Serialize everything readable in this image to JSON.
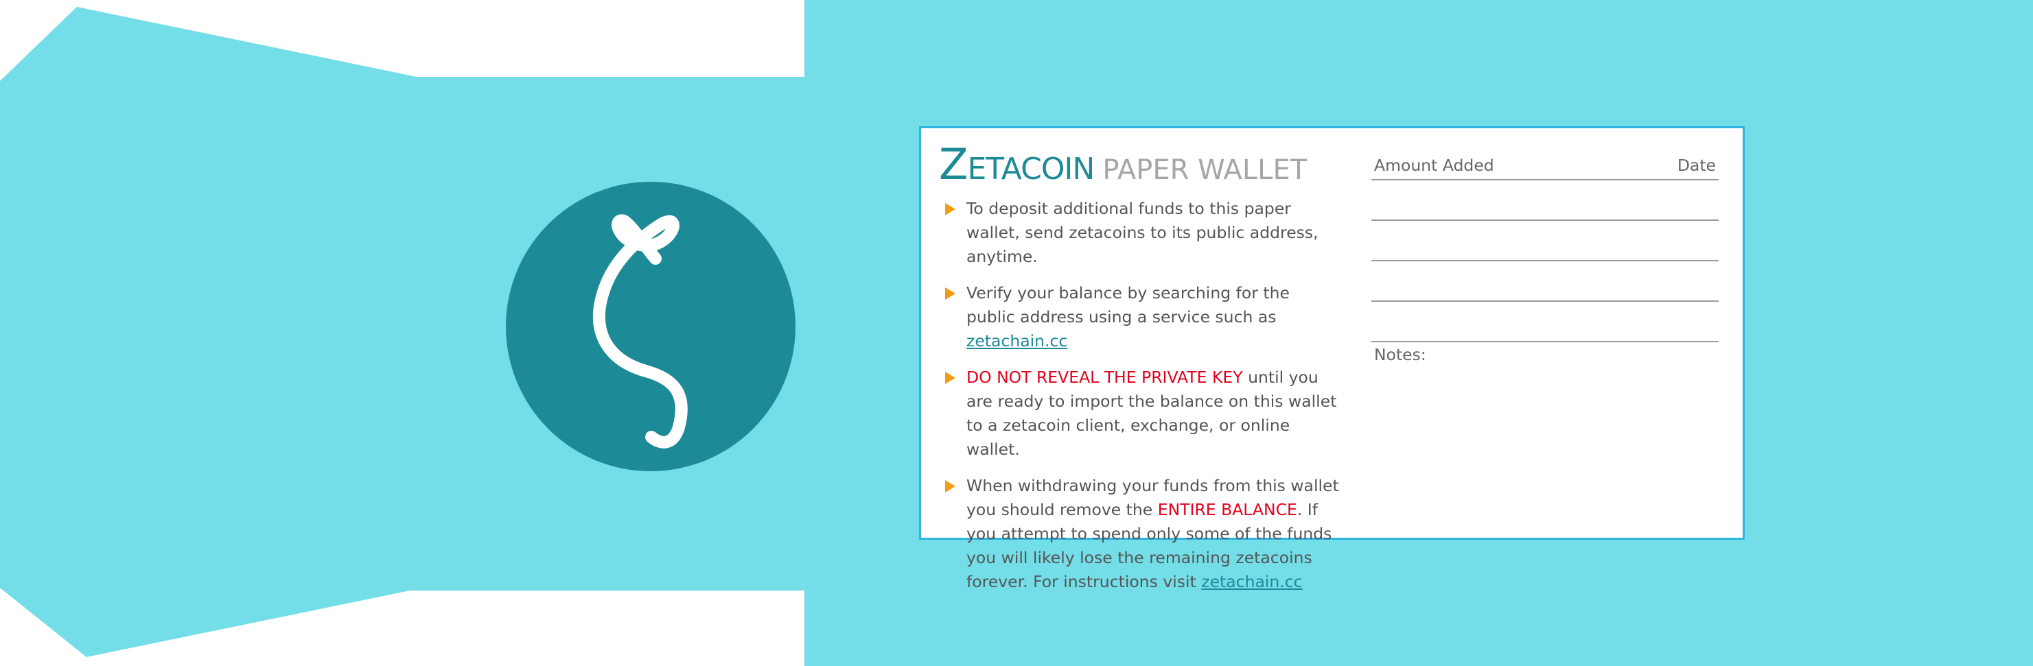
{
  "colors": {
    "background_teal": "#73dee8",
    "logo_circle": "#1d8a98",
    "brand_teal": "#1d8a98",
    "card_border": "#2fb4e0",
    "bullet_arrow": "#f39c12",
    "warning_red": "#e3001b"
  },
  "logo": {
    "symbol": "ζ",
    "icon": "zeta-symbol-icon"
  },
  "card": {
    "title_initial": "Z",
    "title_rest": "ETACOIN",
    "title_sub": "PAPER WALLET",
    "bullets": [
      {
        "text": "To deposit additional funds to this paper wallet, send zetacoins to its public address, anytime."
      },
      {
        "text": "Verify your balance by searching for the public address using a service such as",
        "link": "zetachain.cc"
      },
      {
        "warning": "DO NOT REVEAL THE PRIVATE KEY",
        "text": "until you are ready to import the balance on this wallet to a zetacoin client, exchange, or online wallet."
      },
      {
        "text_before": "When withdrawing your funds from this wallet you should remove the",
        "warning": "ENTIRE BALANCE",
        "text_after": ". If you attempt to spend only some of the funds you will likely lose the remaining zetacoins forever. For instructions visit",
        "link": "zetachain.cc"
      }
    ],
    "ledger": {
      "amount_header": "Amount Added",
      "date_header": "Date",
      "blank_rows": 4,
      "notes_label": "Notes:"
    }
  }
}
